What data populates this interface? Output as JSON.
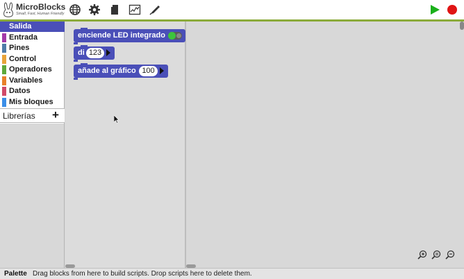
{
  "app": {
    "title": "MicroBlocks",
    "subtitle": "Small, Fast, Human Friendly"
  },
  "toolbar": {
    "icons": [
      "globe-icon",
      "gear-icon",
      "file-icon",
      "graph-icon",
      "usb-pen-icon"
    ],
    "run_color": "#1ab01a",
    "stop_color": "#e01414"
  },
  "categories": [
    {
      "label": "Salida",
      "color": "#4a4fb8",
      "selected": true
    },
    {
      "label": "Entrada",
      "color": "#a33aa8",
      "selected": false
    },
    {
      "label": "Pines",
      "color": "#4f7ca8",
      "selected": false
    },
    {
      "label": "Control",
      "color": "#e8a33a",
      "selected": false
    },
    {
      "label": "Operadores",
      "color": "#5ea83a",
      "selected": false
    },
    {
      "label": "Variables",
      "color": "#e8802a",
      "selected": false
    },
    {
      "label": "Datos",
      "color": "#d04a6a",
      "selected": false
    },
    {
      "label": "Mis bloques",
      "color": "#3a8ee8",
      "selected": false
    }
  ],
  "libraries": {
    "label": "Librerías",
    "add": "+"
  },
  "palette": {
    "blocks": [
      {
        "label": "enciende LED integrado",
        "kind": "toggle"
      },
      {
        "label": "di",
        "value": "123"
      },
      {
        "label": "añade al gráfico",
        "value": "100"
      }
    ]
  },
  "status": {
    "title": "Palette",
    "message": "Drag blocks from here to build scripts. Drop scripts here to delete them."
  }
}
